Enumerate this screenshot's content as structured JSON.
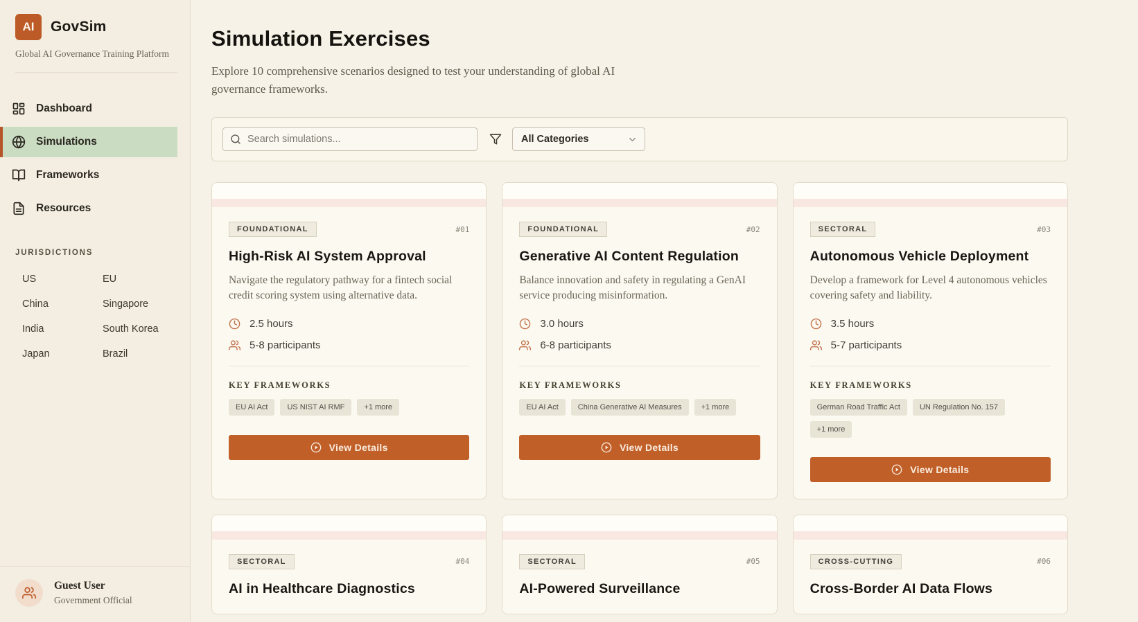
{
  "sidebar": {
    "logo_text": "AI",
    "brand": "GovSim",
    "tagline": "Global AI Governance Training Platform",
    "nav": [
      {
        "label": "Dashboard",
        "icon": "dashboard-icon",
        "active": false
      },
      {
        "label": "Simulations",
        "icon": "globe-icon",
        "active": true
      },
      {
        "label": "Frameworks",
        "icon": "book-icon",
        "active": false
      },
      {
        "label": "Resources",
        "icon": "document-icon",
        "active": false
      }
    ],
    "jurisdictions_label": "JURISDICTIONS",
    "jurisdictions": [
      "US",
      "EU",
      "China",
      "Singapore",
      "India",
      "South Korea",
      "Japan",
      "Brazil"
    ],
    "user": {
      "name": "Guest User",
      "role": "Government Official"
    }
  },
  "header": {
    "title": "Simulation Exercises",
    "subtitle": "Explore 10 comprehensive scenarios designed to test your understanding of global AI governance frameworks."
  },
  "toolbar": {
    "search_placeholder": "Search simulations...",
    "category_filter": "All Categories"
  },
  "labels": {
    "key_frameworks": "KEY FRAMEWORKS",
    "view_details": "View Details"
  },
  "cards": [
    {
      "number": "#01",
      "category": "FOUNDATIONAL",
      "title": "High-Risk AI System Approval",
      "description": "Navigate the regulatory pathway for a fintech social credit scoring system using alternative data.",
      "duration": "2.5 hours",
      "participants": "5-8 participants",
      "frameworks": [
        "EU AI Act",
        "US NIST AI RMF",
        "+1 more"
      ]
    },
    {
      "number": "#02",
      "category": "FOUNDATIONAL",
      "title": "Generative AI Content Regulation",
      "description": "Balance innovation and safety in regulating a GenAI service producing misinformation.",
      "duration": "3.0 hours",
      "participants": "6-8 participants",
      "frameworks": [
        "EU AI Act",
        "China Generative AI Measures",
        "+1 more"
      ]
    },
    {
      "number": "#03",
      "category": "SECTORAL",
      "title": "Autonomous Vehicle Deployment",
      "description": "Develop a framework for Level 4 autonomous vehicles covering safety and liability.",
      "duration": "3.5 hours",
      "participants": "5-7 participants",
      "frameworks": [
        "German Road Traffic Act",
        "UN Regulation No. 157",
        "+1 more"
      ]
    },
    {
      "number": "#04",
      "category": "SECTORAL",
      "title": "AI in Healthcare Diagnostics"
    },
    {
      "number": "#05",
      "category": "SECTORAL",
      "title": "AI-Powered Surveillance"
    },
    {
      "number": "#06",
      "category": "CROSS-CUTTING",
      "title": "Cross-Border AI Data Flows"
    }
  ],
  "colors": {
    "accent_orange": "#bc5b28",
    "button_orange": "#c05f28",
    "active_nav_green": "#cadcc2",
    "card_accent_pink": "#f8e8e1",
    "page_background": "#f7f2e7",
    "sidebar_background": "#f3eee1"
  }
}
